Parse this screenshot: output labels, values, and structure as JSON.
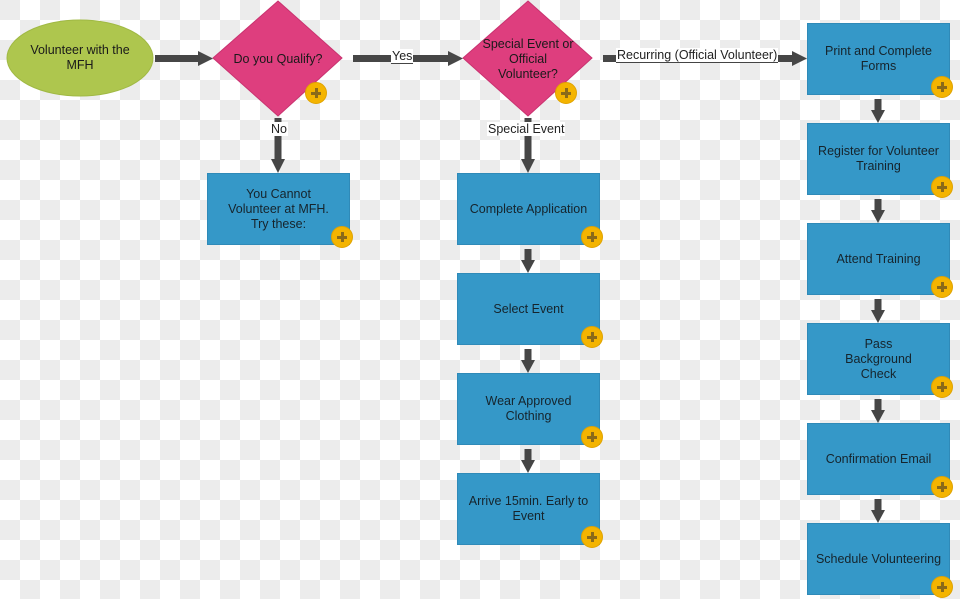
{
  "diagram": {
    "colors": {
      "start": "#aec64e",
      "decision": "#de3e7e",
      "process": "#3598c8",
      "arrow": "#464646",
      "add_button": "#f4b400"
    },
    "start": {
      "label": "Volunteer with the MFH"
    },
    "decisions": [
      {
        "id": "qualify",
        "label": "Do you Qualify?"
      },
      {
        "id": "type",
        "label": "Special Event or Official Volunteer?"
      }
    ],
    "edge_labels": {
      "yes": "Yes",
      "no": "No",
      "special_event": "Special Event",
      "recurring": "Recurring (Official Volunteer)"
    },
    "no_branch": [
      {
        "label": "You Cannot Volunteer at MFH. Try these:"
      }
    ],
    "special_event_steps": [
      {
        "label": "Complete Application"
      },
      {
        "label": "Select Event"
      },
      {
        "label": "Wear Approved Clothing"
      },
      {
        "label": "Arrive 15min. Early to Event"
      }
    ],
    "recurring_steps": [
      {
        "label": "Print and Complete Forms"
      },
      {
        "label": "Register for Volunteer Training"
      },
      {
        "label": "Attend Training"
      },
      {
        "label": "Pass Background Check"
      },
      {
        "label": "Confirmation Email"
      },
      {
        "label": "Schedule Volunteering"
      }
    ],
    "add_icon": "plus-icon"
  }
}
